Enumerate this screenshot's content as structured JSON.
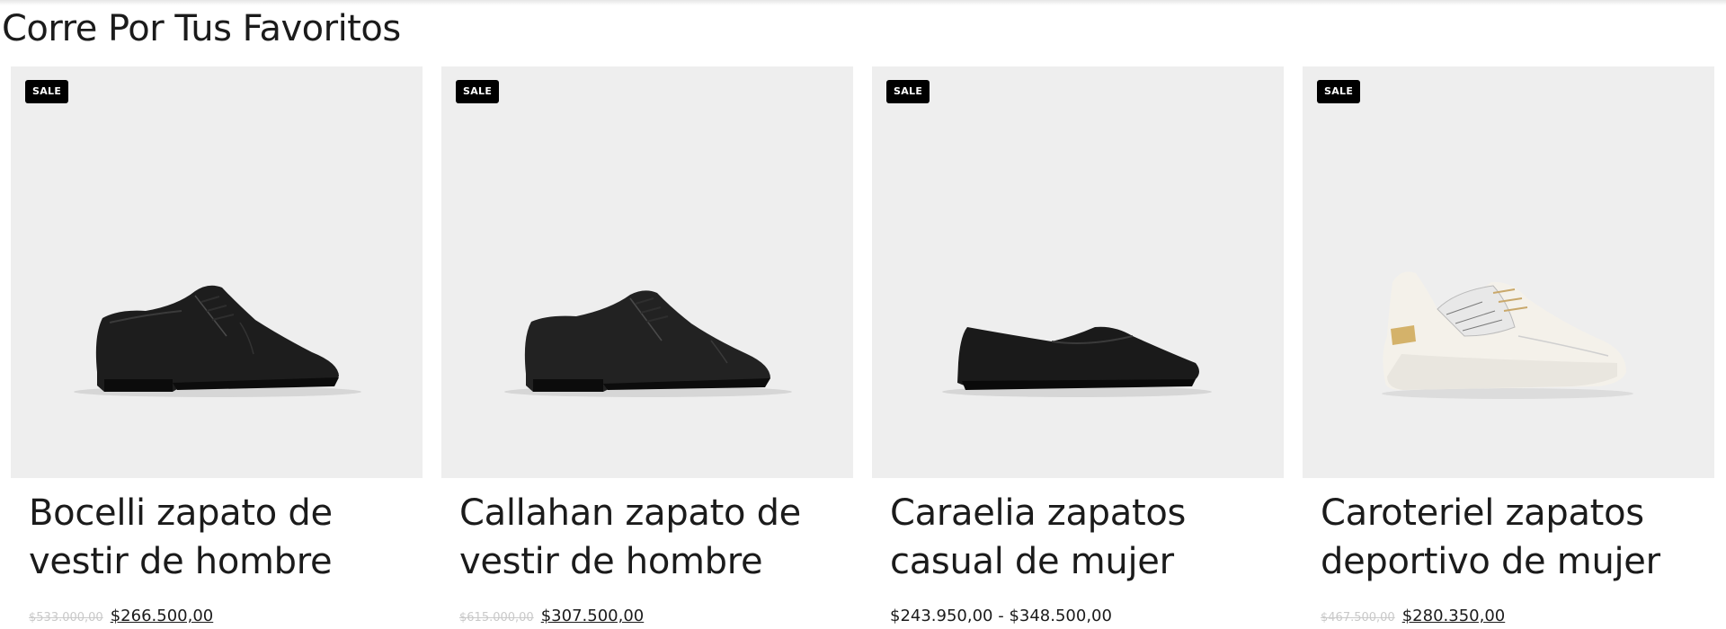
{
  "section": {
    "title": "Corre Por Tus Favoritos"
  },
  "colors": {
    "card_bg": "#eeeeee",
    "badge_bg": "#000000",
    "text": "#1b1b1b",
    "old_price": "#c9c9c9"
  },
  "products": [
    {
      "badge": "SALE",
      "image_icon": "black-oxford-dress-shoe",
      "name": "Bocelli zapato de vestir de hombre",
      "old_price": "$533.000,00",
      "price": "$266.500,00"
    },
    {
      "badge": "SALE",
      "image_icon": "black-derby-dress-shoe",
      "name": "Callahan zapato de vestir de hombre",
      "old_price": "$615.000,00",
      "price": "$307.500,00"
    },
    {
      "badge": "SALE",
      "image_icon": "black-loafer-flat",
      "name": "Caraelia zapatos casual de mujer",
      "price_range": "$243.950,00 - $348.500,00"
    },
    {
      "badge": "SALE",
      "image_icon": "white-wedge-sneaker",
      "name": "Caroteriel zapatos deportivo de mujer",
      "old_price": "$467.500,00",
      "price": "$280.350,00"
    }
  ]
}
